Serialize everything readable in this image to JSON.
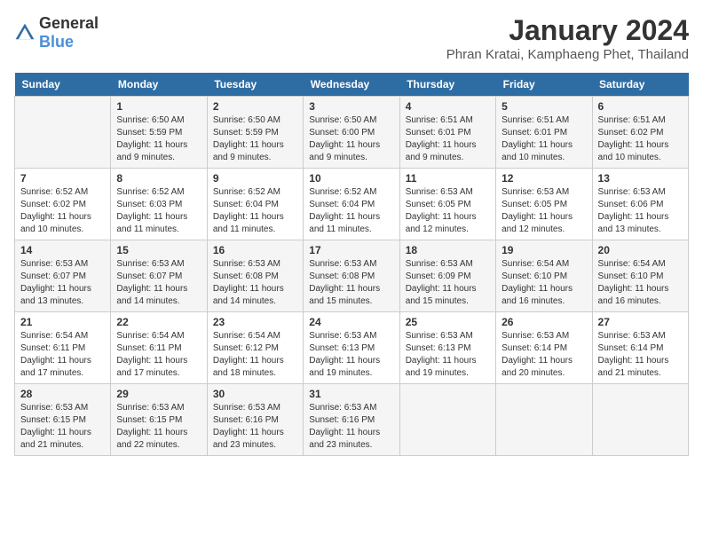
{
  "logo": {
    "general": "General",
    "blue": "Blue"
  },
  "title": "January 2024",
  "location": "Phran Kratai, Kamphaeng Phet, Thailand",
  "headers": [
    "Sunday",
    "Monday",
    "Tuesday",
    "Wednesday",
    "Thursday",
    "Friday",
    "Saturday"
  ],
  "weeks": [
    [
      {
        "day": "",
        "sunrise": "",
        "sunset": "",
        "daylight": ""
      },
      {
        "day": "1",
        "sunrise": "Sunrise: 6:50 AM",
        "sunset": "Sunset: 5:59 PM",
        "daylight": "Daylight: 11 hours and 9 minutes."
      },
      {
        "day": "2",
        "sunrise": "Sunrise: 6:50 AM",
        "sunset": "Sunset: 5:59 PM",
        "daylight": "Daylight: 11 hours and 9 minutes."
      },
      {
        "day": "3",
        "sunrise": "Sunrise: 6:50 AM",
        "sunset": "Sunset: 6:00 PM",
        "daylight": "Daylight: 11 hours and 9 minutes."
      },
      {
        "day": "4",
        "sunrise": "Sunrise: 6:51 AM",
        "sunset": "Sunset: 6:01 PM",
        "daylight": "Daylight: 11 hours and 9 minutes."
      },
      {
        "day": "5",
        "sunrise": "Sunrise: 6:51 AM",
        "sunset": "Sunset: 6:01 PM",
        "daylight": "Daylight: 11 hours and 10 minutes."
      },
      {
        "day": "6",
        "sunrise": "Sunrise: 6:51 AM",
        "sunset": "Sunset: 6:02 PM",
        "daylight": "Daylight: 11 hours and 10 minutes."
      }
    ],
    [
      {
        "day": "7",
        "sunrise": "Sunrise: 6:52 AM",
        "sunset": "Sunset: 6:02 PM",
        "daylight": "Daylight: 11 hours and 10 minutes."
      },
      {
        "day": "8",
        "sunrise": "Sunrise: 6:52 AM",
        "sunset": "Sunset: 6:03 PM",
        "daylight": "Daylight: 11 hours and 11 minutes."
      },
      {
        "day": "9",
        "sunrise": "Sunrise: 6:52 AM",
        "sunset": "Sunset: 6:04 PM",
        "daylight": "Daylight: 11 hours and 11 minutes."
      },
      {
        "day": "10",
        "sunrise": "Sunrise: 6:52 AM",
        "sunset": "Sunset: 6:04 PM",
        "daylight": "Daylight: 11 hours and 11 minutes."
      },
      {
        "day": "11",
        "sunrise": "Sunrise: 6:53 AM",
        "sunset": "Sunset: 6:05 PM",
        "daylight": "Daylight: 11 hours and 12 minutes."
      },
      {
        "day": "12",
        "sunrise": "Sunrise: 6:53 AM",
        "sunset": "Sunset: 6:05 PM",
        "daylight": "Daylight: 11 hours and 12 minutes."
      },
      {
        "day": "13",
        "sunrise": "Sunrise: 6:53 AM",
        "sunset": "Sunset: 6:06 PM",
        "daylight": "Daylight: 11 hours and 13 minutes."
      }
    ],
    [
      {
        "day": "14",
        "sunrise": "Sunrise: 6:53 AM",
        "sunset": "Sunset: 6:07 PM",
        "daylight": "Daylight: 11 hours and 13 minutes."
      },
      {
        "day": "15",
        "sunrise": "Sunrise: 6:53 AM",
        "sunset": "Sunset: 6:07 PM",
        "daylight": "Daylight: 11 hours and 14 minutes."
      },
      {
        "day": "16",
        "sunrise": "Sunrise: 6:53 AM",
        "sunset": "Sunset: 6:08 PM",
        "daylight": "Daylight: 11 hours and 14 minutes."
      },
      {
        "day": "17",
        "sunrise": "Sunrise: 6:53 AM",
        "sunset": "Sunset: 6:08 PM",
        "daylight": "Daylight: 11 hours and 15 minutes."
      },
      {
        "day": "18",
        "sunrise": "Sunrise: 6:53 AM",
        "sunset": "Sunset: 6:09 PM",
        "daylight": "Daylight: 11 hours and 15 minutes."
      },
      {
        "day": "19",
        "sunrise": "Sunrise: 6:54 AM",
        "sunset": "Sunset: 6:10 PM",
        "daylight": "Daylight: 11 hours and 16 minutes."
      },
      {
        "day": "20",
        "sunrise": "Sunrise: 6:54 AM",
        "sunset": "Sunset: 6:10 PM",
        "daylight": "Daylight: 11 hours and 16 minutes."
      }
    ],
    [
      {
        "day": "21",
        "sunrise": "Sunrise: 6:54 AM",
        "sunset": "Sunset: 6:11 PM",
        "daylight": "Daylight: 11 hours and 17 minutes."
      },
      {
        "day": "22",
        "sunrise": "Sunrise: 6:54 AM",
        "sunset": "Sunset: 6:11 PM",
        "daylight": "Daylight: 11 hours and 17 minutes."
      },
      {
        "day": "23",
        "sunrise": "Sunrise: 6:54 AM",
        "sunset": "Sunset: 6:12 PM",
        "daylight": "Daylight: 11 hours and 18 minutes."
      },
      {
        "day": "24",
        "sunrise": "Sunrise: 6:53 AM",
        "sunset": "Sunset: 6:13 PM",
        "daylight": "Daylight: 11 hours and 19 minutes."
      },
      {
        "day": "25",
        "sunrise": "Sunrise: 6:53 AM",
        "sunset": "Sunset: 6:13 PM",
        "daylight": "Daylight: 11 hours and 19 minutes."
      },
      {
        "day": "26",
        "sunrise": "Sunrise: 6:53 AM",
        "sunset": "Sunset: 6:14 PM",
        "daylight": "Daylight: 11 hours and 20 minutes."
      },
      {
        "day": "27",
        "sunrise": "Sunrise: 6:53 AM",
        "sunset": "Sunset: 6:14 PM",
        "daylight": "Daylight: 11 hours and 21 minutes."
      }
    ],
    [
      {
        "day": "28",
        "sunrise": "Sunrise: 6:53 AM",
        "sunset": "Sunset: 6:15 PM",
        "daylight": "Daylight: 11 hours and 21 minutes."
      },
      {
        "day": "29",
        "sunrise": "Sunrise: 6:53 AM",
        "sunset": "Sunset: 6:15 PM",
        "daylight": "Daylight: 11 hours and 22 minutes."
      },
      {
        "day": "30",
        "sunrise": "Sunrise: 6:53 AM",
        "sunset": "Sunset: 6:16 PM",
        "daylight": "Daylight: 11 hours and 23 minutes."
      },
      {
        "day": "31",
        "sunrise": "Sunrise: 6:53 AM",
        "sunset": "Sunset: 6:16 PM",
        "daylight": "Daylight: 11 hours and 23 minutes."
      },
      {
        "day": "",
        "sunrise": "",
        "sunset": "",
        "daylight": ""
      },
      {
        "day": "",
        "sunrise": "",
        "sunset": "",
        "daylight": ""
      },
      {
        "day": "",
        "sunrise": "",
        "sunset": "",
        "daylight": ""
      }
    ]
  ]
}
